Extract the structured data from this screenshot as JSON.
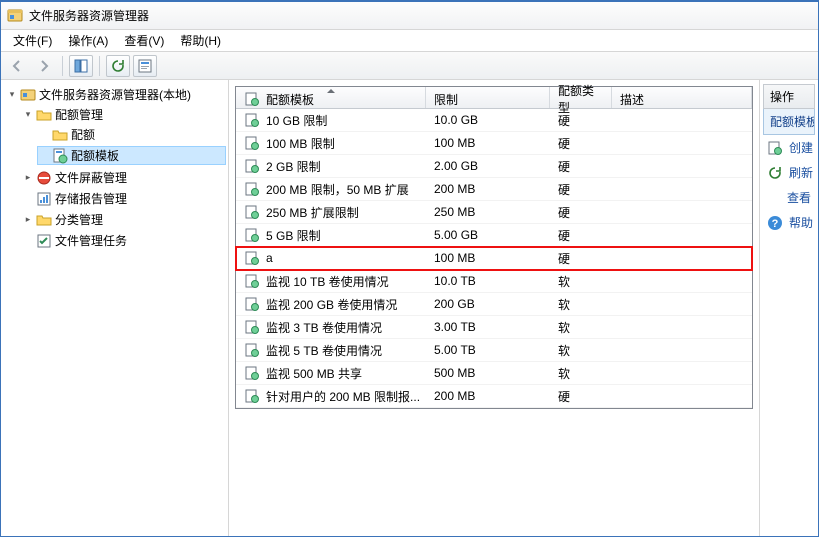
{
  "window": {
    "title": "文件服务器资源管理器"
  },
  "menu": {
    "file": "文件(F)",
    "action": "操作(A)",
    "view": "查看(V)",
    "help": "帮助(H)"
  },
  "tree": {
    "root": "文件服务器资源管理器(本地)",
    "quota_mgmt": "配额管理",
    "quota": "配额",
    "quota_template": "配额模板",
    "file_screen": "文件屏蔽管理",
    "storage_reports": "存储报告管理",
    "classification": "分类管理",
    "file_tasks": "文件管理任务"
  },
  "columns": {
    "template": "配额模板",
    "limit": "限制",
    "type": "配额类型",
    "desc": "描述"
  },
  "rows": [
    {
      "name": "10 GB 限制",
      "limit": "10.0 GB",
      "type": "硬"
    },
    {
      "name": "100 MB 限制",
      "limit": "100 MB",
      "type": "硬"
    },
    {
      "name": "2 GB 限制",
      "limit": "2.00 GB",
      "type": "硬"
    },
    {
      "name": "200 MB 限制，50 MB 扩展",
      "limit": "200 MB",
      "type": "硬"
    },
    {
      "name": "250 MB 扩展限制",
      "limit": "250 MB",
      "type": "硬"
    },
    {
      "name": "5 GB 限制",
      "limit": "5.00 GB",
      "type": "硬"
    },
    {
      "name": "a",
      "limit": "100 MB",
      "type": "硬",
      "highlight": true
    },
    {
      "name": "监视 10 TB 卷使用情况",
      "limit": "10.0 TB",
      "type": "软"
    },
    {
      "name": "监视 200 GB 卷使用情况",
      "limit": "200 GB",
      "type": "软"
    },
    {
      "name": "监视 3 TB 卷使用情况",
      "limit": "3.00 TB",
      "type": "软"
    },
    {
      "name": "监视 5 TB 卷使用情况",
      "limit": "5.00 TB",
      "type": "软"
    },
    {
      "name": "监视 500 MB 共享",
      "limit": "500 MB",
      "type": "软"
    },
    {
      "name": "针对用户的 200 MB 限制报...",
      "limit": "200 MB",
      "type": "硬"
    }
  ],
  "actions": {
    "header": "操作",
    "section": "配额模板",
    "create": "创建",
    "refresh": "刷新",
    "view": "查看",
    "help": "帮助"
  }
}
